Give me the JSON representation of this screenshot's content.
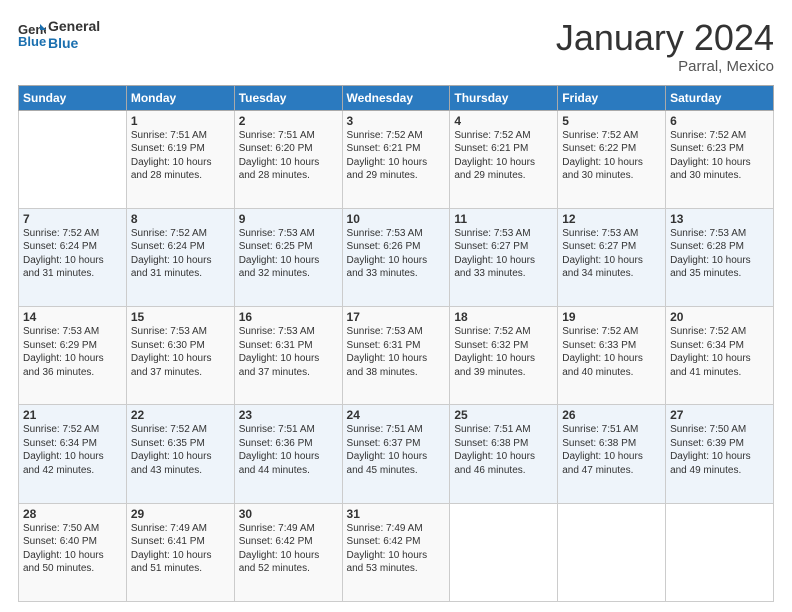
{
  "logo": {
    "line1": "General",
    "line2": "Blue"
  },
  "header": {
    "title": "January 2024",
    "subtitle": "Parral, Mexico"
  },
  "weekdays": [
    "Sunday",
    "Monday",
    "Tuesday",
    "Wednesday",
    "Thursday",
    "Friday",
    "Saturday"
  ],
  "weeks": [
    [
      {
        "day": "",
        "sunrise": "",
        "sunset": "",
        "daylight": ""
      },
      {
        "day": "1",
        "sunrise": "Sunrise: 7:51 AM",
        "sunset": "Sunset: 6:19 PM",
        "daylight": "Daylight: 10 hours and 28 minutes."
      },
      {
        "day": "2",
        "sunrise": "Sunrise: 7:51 AM",
        "sunset": "Sunset: 6:20 PM",
        "daylight": "Daylight: 10 hours and 28 minutes."
      },
      {
        "day": "3",
        "sunrise": "Sunrise: 7:52 AM",
        "sunset": "Sunset: 6:21 PM",
        "daylight": "Daylight: 10 hours and 29 minutes."
      },
      {
        "day": "4",
        "sunrise": "Sunrise: 7:52 AM",
        "sunset": "Sunset: 6:21 PM",
        "daylight": "Daylight: 10 hours and 29 minutes."
      },
      {
        "day": "5",
        "sunrise": "Sunrise: 7:52 AM",
        "sunset": "Sunset: 6:22 PM",
        "daylight": "Daylight: 10 hours and 30 minutes."
      },
      {
        "day": "6",
        "sunrise": "Sunrise: 7:52 AM",
        "sunset": "Sunset: 6:23 PM",
        "daylight": "Daylight: 10 hours and 30 minutes."
      }
    ],
    [
      {
        "day": "7",
        "sunrise": "Sunrise: 7:52 AM",
        "sunset": "Sunset: 6:24 PM",
        "daylight": "Daylight: 10 hours and 31 minutes."
      },
      {
        "day": "8",
        "sunrise": "Sunrise: 7:52 AM",
        "sunset": "Sunset: 6:24 PM",
        "daylight": "Daylight: 10 hours and 31 minutes."
      },
      {
        "day": "9",
        "sunrise": "Sunrise: 7:53 AM",
        "sunset": "Sunset: 6:25 PM",
        "daylight": "Daylight: 10 hours and 32 minutes."
      },
      {
        "day": "10",
        "sunrise": "Sunrise: 7:53 AM",
        "sunset": "Sunset: 6:26 PM",
        "daylight": "Daylight: 10 hours and 33 minutes."
      },
      {
        "day": "11",
        "sunrise": "Sunrise: 7:53 AM",
        "sunset": "Sunset: 6:27 PM",
        "daylight": "Daylight: 10 hours and 33 minutes."
      },
      {
        "day": "12",
        "sunrise": "Sunrise: 7:53 AM",
        "sunset": "Sunset: 6:27 PM",
        "daylight": "Daylight: 10 hours and 34 minutes."
      },
      {
        "day": "13",
        "sunrise": "Sunrise: 7:53 AM",
        "sunset": "Sunset: 6:28 PM",
        "daylight": "Daylight: 10 hours and 35 minutes."
      }
    ],
    [
      {
        "day": "14",
        "sunrise": "Sunrise: 7:53 AM",
        "sunset": "Sunset: 6:29 PM",
        "daylight": "Daylight: 10 hours and 36 minutes."
      },
      {
        "day": "15",
        "sunrise": "Sunrise: 7:53 AM",
        "sunset": "Sunset: 6:30 PM",
        "daylight": "Daylight: 10 hours and 37 minutes."
      },
      {
        "day": "16",
        "sunrise": "Sunrise: 7:53 AM",
        "sunset": "Sunset: 6:31 PM",
        "daylight": "Daylight: 10 hours and 37 minutes."
      },
      {
        "day": "17",
        "sunrise": "Sunrise: 7:53 AM",
        "sunset": "Sunset: 6:31 PM",
        "daylight": "Daylight: 10 hours and 38 minutes."
      },
      {
        "day": "18",
        "sunrise": "Sunrise: 7:52 AM",
        "sunset": "Sunset: 6:32 PM",
        "daylight": "Daylight: 10 hours and 39 minutes."
      },
      {
        "day": "19",
        "sunrise": "Sunrise: 7:52 AM",
        "sunset": "Sunset: 6:33 PM",
        "daylight": "Daylight: 10 hours and 40 minutes."
      },
      {
        "day": "20",
        "sunrise": "Sunrise: 7:52 AM",
        "sunset": "Sunset: 6:34 PM",
        "daylight": "Daylight: 10 hours and 41 minutes."
      }
    ],
    [
      {
        "day": "21",
        "sunrise": "Sunrise: 7:52 AM",
        "sunset": "Sunset: 6:34 PM",
        "daylight": "Daylight: 10 hours and 42 minutes."
      },
      {
        "day": "22",
        "sunrise": "Sunrise: 7:52 AM",
        "sunset": "Sunset: 6:35 PM",
        "daylight": "Daylight: 10 hours and 43 minutes."
      },
      {
        "day": "23",
        "sunrise": "Sunrise: 7:51 AM",
        "sunset": "Sunset: 6:36 PM",
        "daylight": "Daylight: 10 hours and 44 minutes."
      },
      {
        "day": "24",
        "sunrise": "Sunrise: 7:51 AM",
        "sunset": "Sunset: 6:37 PM",
        "daylight": "Daylight: 10 hours and 45 minutes."
      },
      {
        "day": "25",
        "sunrise": "Sunrise: 7:51 AM",
        "sunset": "Sunset: 6:38 PM",
        "daylight": "Daylight: 10 hours and 46 minutes."
      },
      {
        "day": "26",
        "sunrise": "Sunrise: 7:51 AM",
        "sunset": "Sunset: 6:38 PM",
        "daylight": "Daylight: 10 hours and 47 minutes."
      },
      {
        "day": "27",
        "sunrise": "Sunrise: 7:50 AM",
        "sunset": "Sunset: 6:39 PM",
        "daylight": "Daylight: 10 hours and 49 minutes."
      }
    ],
    [
      {
        "day": "28",
        "sunrise": "Sunrise: 7:50 AM",
        "sunset": "Sunset: 6:40 PM",
        "daylight": "Daylight: 10 hours and 50 minutes."
      },
      {
        "day": "29",
        "sunrise": "Sunrise: 7:49 AM",
        "sunset": "Sunset: 6:41 PM",
        "daylight": "Daylight: 10 hours and 51 minutes."
      },
      {
        "day": "30",
        "sunrise": "Sunrise: 7:49 AM",
        "sunset": "Sunset: 6:42 PM",
        "daylight": "Daylight: 10 hours and 52 minutes."
      },
      {
        "day": "31",
        "sunrise": "Sunrise: 7:49 AM",
        "sunset": "Sunset: 6:42 PM",
        "daylight": "Daylight: 10 hours and 53 minutes."
      },
      {
        "day": "",
        "sunrise": "",
        "sunset": "",
        "daylight": ""
      },
      {
        "day": "",
        "sunrise": "",
        "sunset": "",
        "daylight": ""
      },
      {
        "day": "",
        "sunrise": "",
        "sunset": "",
        "daylight": ""
      }
    ]
  ]
}
